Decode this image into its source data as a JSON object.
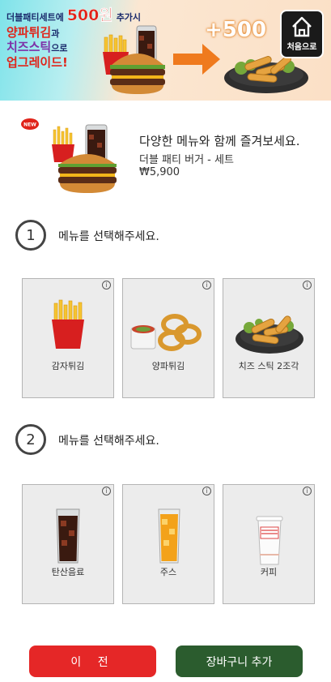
{
  "banner": {
    "line1_prefix": "더블패티세트에",
    "line1_amount": "500원",
    "line1_suffix": "추가시",
    "line2_item": "양파튀김",
    "line2_suffix": "과",
    "line3_item": "치즈스틱",
    "line3_suffix": "으로",
    "line4": "업그레이드!",
    "plus_amount": "+500",
    "home_label": "처음으로"
  },
  "product": {
    "badge": "NEW",
    "intro": "다양한 메뉴와 함께 즐겨보세요.",
    "name": "더블 패티 버거 - 세트",
    "price": "₩5,900"
  },
  "steps": [
    {
      "number": "1",
      "label": "메뉴를 선택해주세요.",
      "options": [
        {
          "label": "감자튀김",
          "icon": "fries-icon"
        },
        {
          "label": "양파튀김",
          "icon": "onion-rings-icon"
        },
        {
          "label": "치즈 스틱 2조각",
          "icon": "cheese-sticks-icon"
        }
      ]
    },
    {
      "number": "2",
      "label": "메뉴를 선택해주세요.",
      "options": [
        {
          "label": "탄산음료",
          "icon": "cola-icon"
        },
        {
          "label": "주스",
          "icon": "juice-icon"
        },
        {
          "label": "커피",
          "icon": "coffee-cup-icon"
        }
      ]
    }
  ],
  "info_glyph": "i",
  "buttons": {
    "prev": "이 전",
    "add_to_cart": "장바구니 추가"
  },
  "colors": {
    "prev_button": "#e52727",
    "cart_button": "#2b5c2e",
    "promo_red": "#e0241a"
  }
}
